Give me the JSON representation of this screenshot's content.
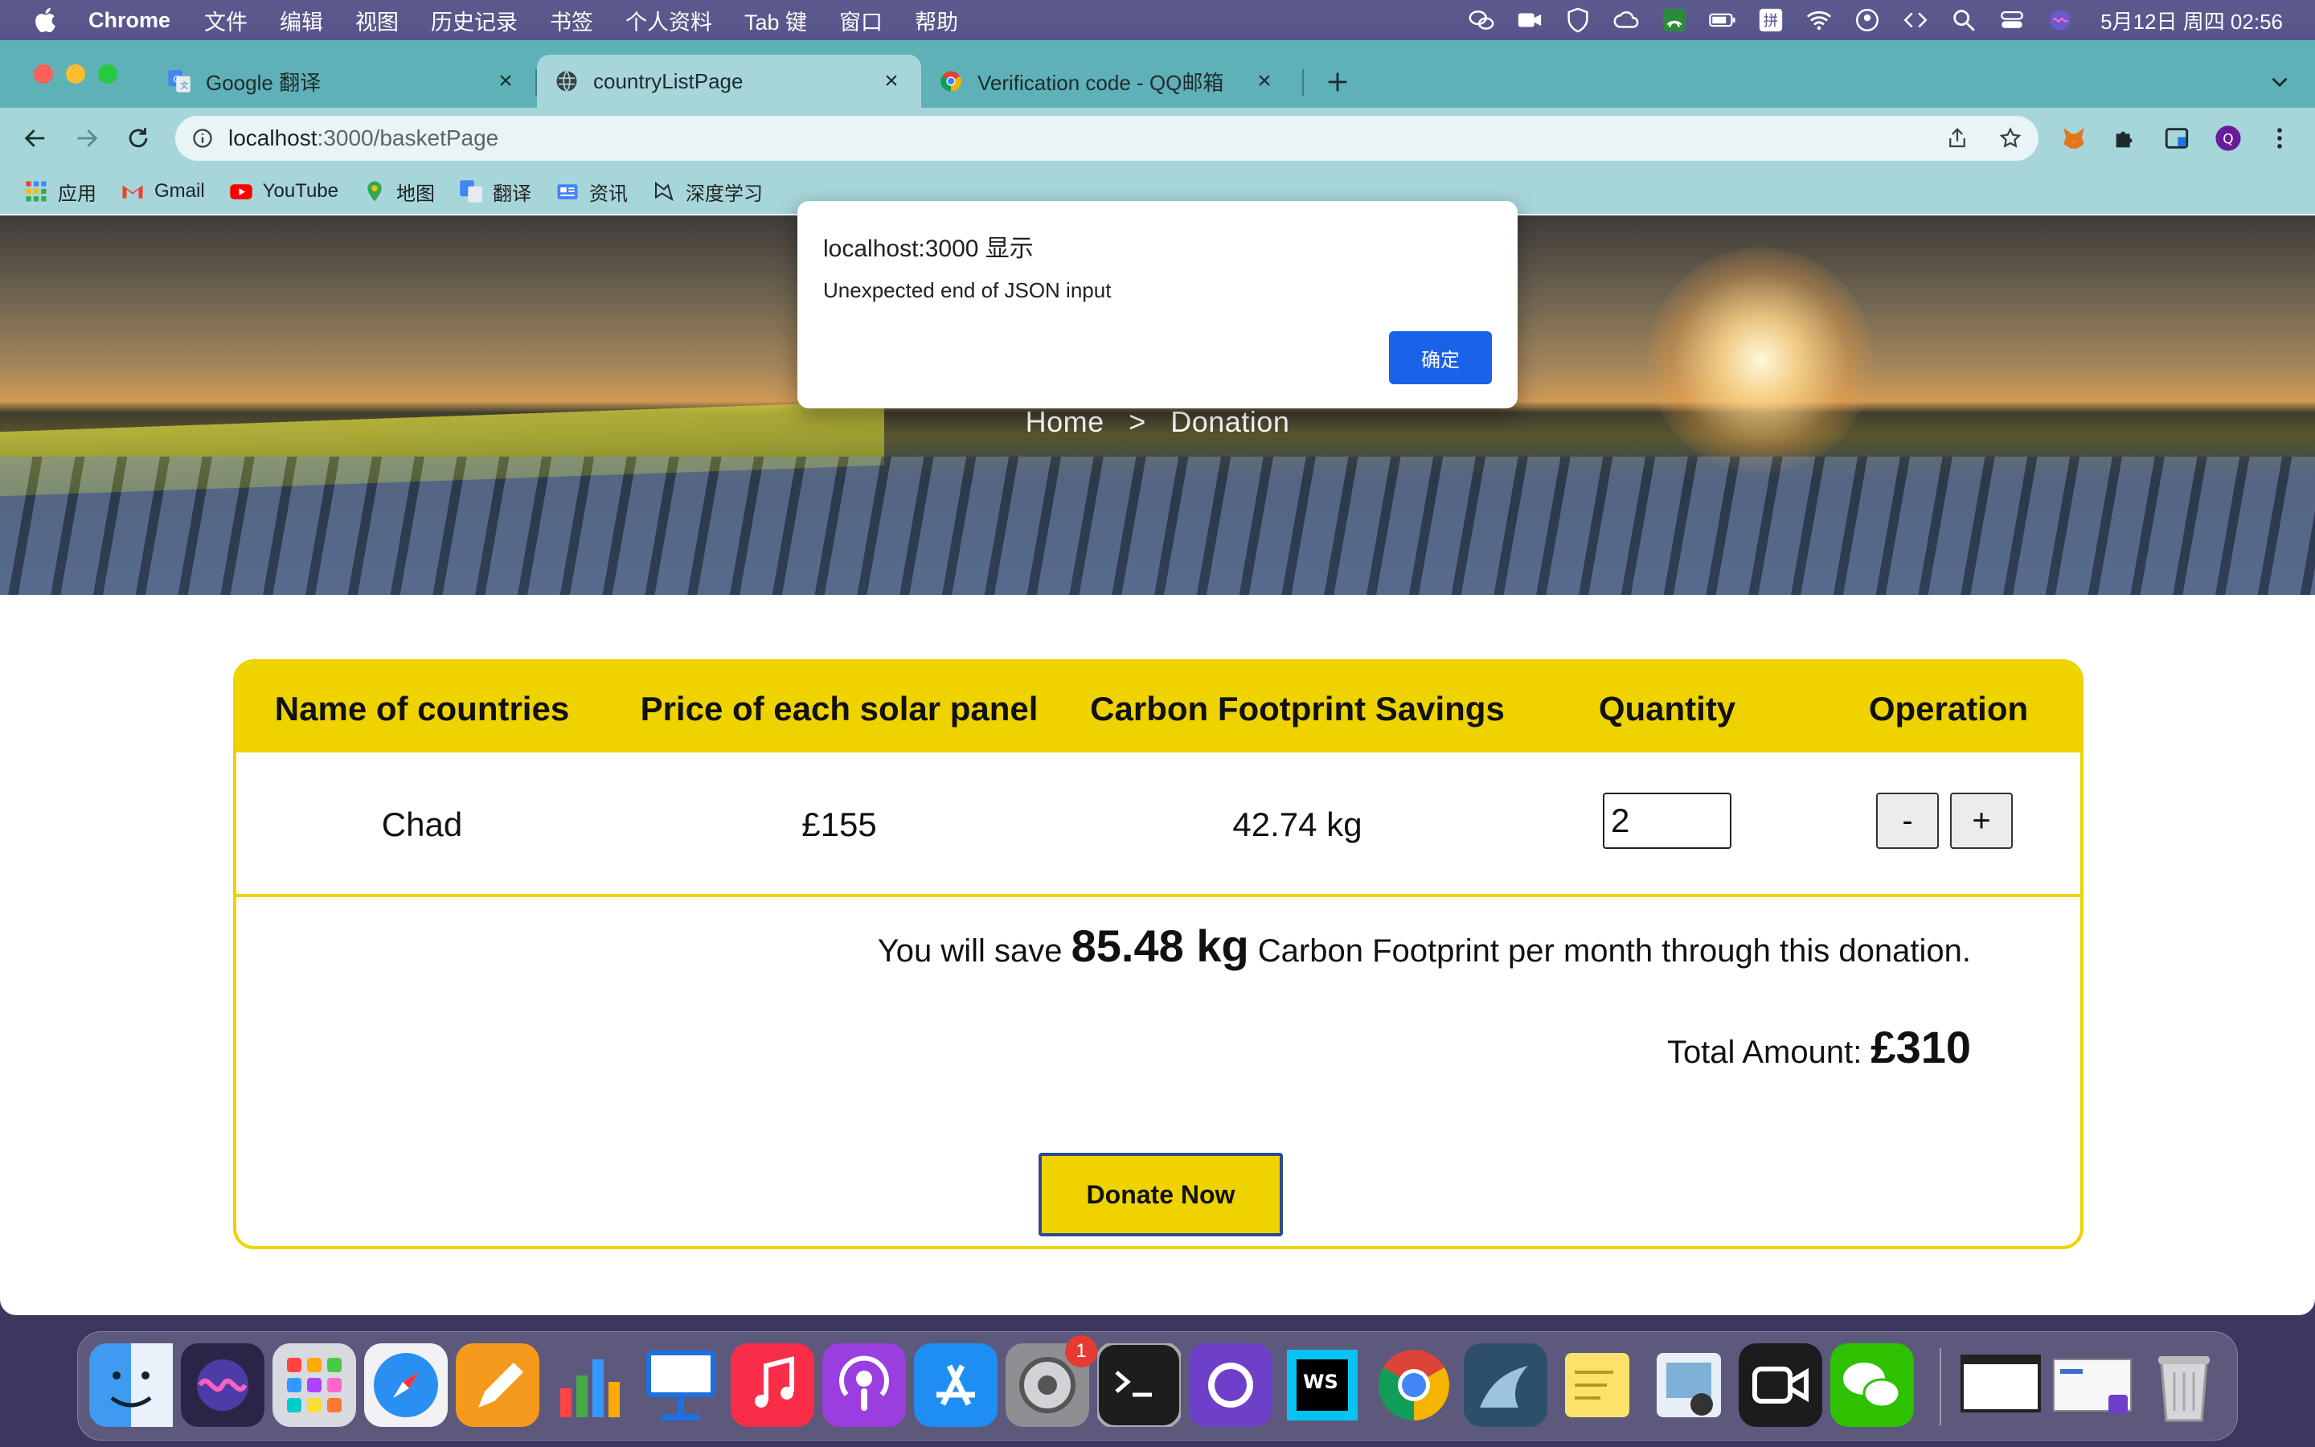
{
  "menubar": {
    "app_name": "Chrome",
    "items": [
      "文件",
      "编辑",
      "视图",
      "历史记录",
      "书签",
      "个人资料",
      "Tab 键",
      "窗口",
      "帮助"
    ],
    "clock": "5月12日 周四  02:56"
  },
  "tabs": [
    {
      "title": "Google 翻译",
      "icon": "google-translate-icon"
    },
    {
      "title": "countryListPage",
      "icon": "globe-icon"
    },
    {
      "title": "Verification code - QQ邮箱",
      "icon": "chrome-icon"
    }
  ],
  "omnibox": {
    "host": "localhost",
    "path": ":3000/basketPage"
  },
  "bookmarks": [
    "应用",
    "Gmail",
    "YouTube",
    "地图",
    "翻译",
    "资讯",
    "深度学习"
  ],
  "hero": {
    "crumb_home": "Home",
    "crumb_sep": ">",
    "crumb_current": "Donation"
  },
  "table": {
    "headers": [
      "Name of countries",
      "Price of each solar panel",
      "Carbon Footprint Savings",
      "Quantity",
      "Operation"
    ],
    "row": {
      "country": "Chad",
      "price": "£155",
      "savings": "42.74 kg",
      "quantity": "2"
    },
    "minus_label": "-",
    "plus_label": "+"
  },
  "summary": {
    "save_prefix": "You will save ",
    "save_amount": "85.48 kg",
    "save_suffix": " Carbon Footprint per month through this donation.",
    "total_label": "Total Amount: ",
    "total_value": "£310",
    "donate_label": "Donate Now"
  },
  "alert": {
    "title": "localhost:3000 显示",
    "message": "Unexpected end of JSON input",
    "ok_label": "确定"
  },
  "dock": {
    "badge_count": "1",
    "apps": [
      "finder-icon",
      "siri-icon",
      "launchpad-icon",
      "safari-icon",
      "pages-icon",
      "numbers-icon",
      "keynote-icon",
      "music-icon",
      "podcasts-icon",
      "app-store-icon",
      "system-preferences-icon",
      "terminal-icon",
      "github-desktop-icon",
      "webstorm-icon",
      "chrome-icon",
      "mysql-workbench-icon",
      "stickies-icon",
      "preview-icon",
      "facetime-icon",
      "wechat-icon",
      "window-thumbnail-icon",
      "window-thumbnail-icon",
      "trash-icon"
    ]
  }
}
